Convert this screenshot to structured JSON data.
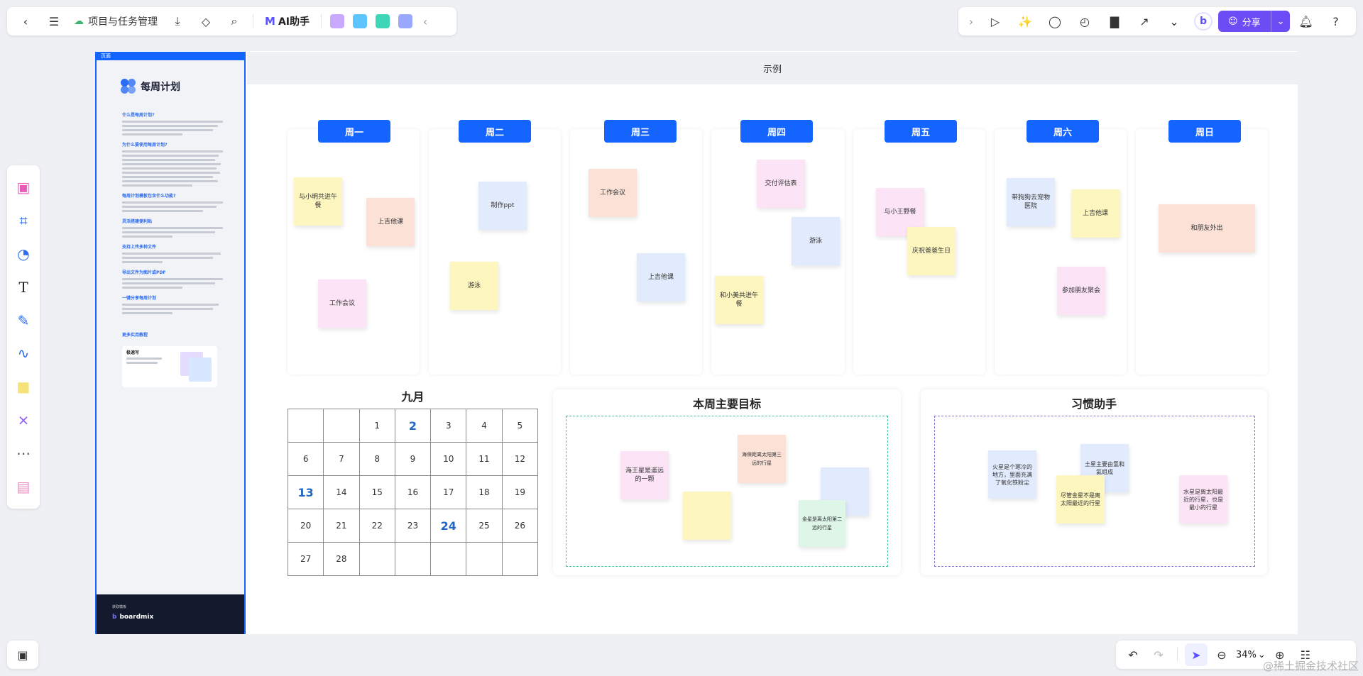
{
  "toolbar": {
    "title": "项目与任务管理",
    "ai_label": "AI助手",
    "ai_logo": "M",
    "share_label": "分享"
  },
  "board": {
    "frame_label": "页面",
    "header": "示例"
  },
  "template_panel": {
    "title": "每周计划",
    "sections": [
      "什么是每周计划?",
      "为什么要使用每周计划?",
      "每周计划模板包含什么功能?",
      "灵活搭建便利贴",
      "支持上传多种文件",
      "导出文件为图片或PDF",
      "一键分享每周计划"
    ],
    "more_label": "更多实用教程",
    "card_title": "极速写",
    "footer_small": "获取模板",
    "footer_brand": "boardmix"
  },
  "days": [
    {
      "label": "周一"
    },
    {
      "label": "周二"
    },
    {
      "label": "周三"
    },
    {
      "label": "周四"
    },
    {
      "label": "周五"
    },
    {
      "label": "周六"
    },
    {
      "label": "周日"
    }
  ],
  "stickies": {
    "mon1": "与小明共进午餐",
    "mon2": "上吉他课",
    "mon3": "工作会议",
    "tue1": "制作ppt",
    "tue2": "游泳",
    "wed1": "工作会议",
    "wed2": "上吉他课",
    "thu1": "交付评估表",
    "thu2": "游泳",
    "thu3": "和小美共进午餐",
    "fri1": "与小王野餐",
    "fri2": "庆祝爸爸生日",
    "sat1": "带狗狗去宠物医院",
    "sat2": "上吉他课",
    "sat3": "参加朋友聚会",
    "sun1": "和朋友外出"
  },
  "calendar": {
    "title": "九月",
    "rows": [
      [
        "",
        "",
        "1",
        "2",
        "3",
        "4",
        "5"
      ],
      [
        "6",
        "7",
        "8",
        "9",
        "10",
        "11",
        "12"
      ],
      [
        "13",
        "14",
        "15",
        "16",
        "17",
        "18",
        "19"
      ],
      [
        "20",
        "21",
        "22",
        "23",
        "24",
        "25",
        "26"
      ],
      [
        "27",
        "28",
        "",
        "",
        "",
        "",
        ""
      ]
    ],
    "highlighted": [
      "2",
      "13",
      "24"
    ]
  },
  "goals": {
    "title": "本周主要目标",
    "notes": [
      "海王星是遥远的一颗",
      "",
      "海保距离太阳第三远的行星",
      "",
      "金星是离太阳第二远的行星"
    ]
  },
  "habits": {
    "title": "习惯助手",
    "notes": [
      "火星是个寒冷的地方，里面充满了氧化铁粉尘",
      "土星主要由氢和氦组成",
      "尽管金星不是离太阳最近的行星",
      "水星是离太阳最近的行星，也是最小的行星"
    ]
  },
  "zoom": {
    "level": "34%"
  },
  "watermark": "@稀土掘金技术社区"
}
